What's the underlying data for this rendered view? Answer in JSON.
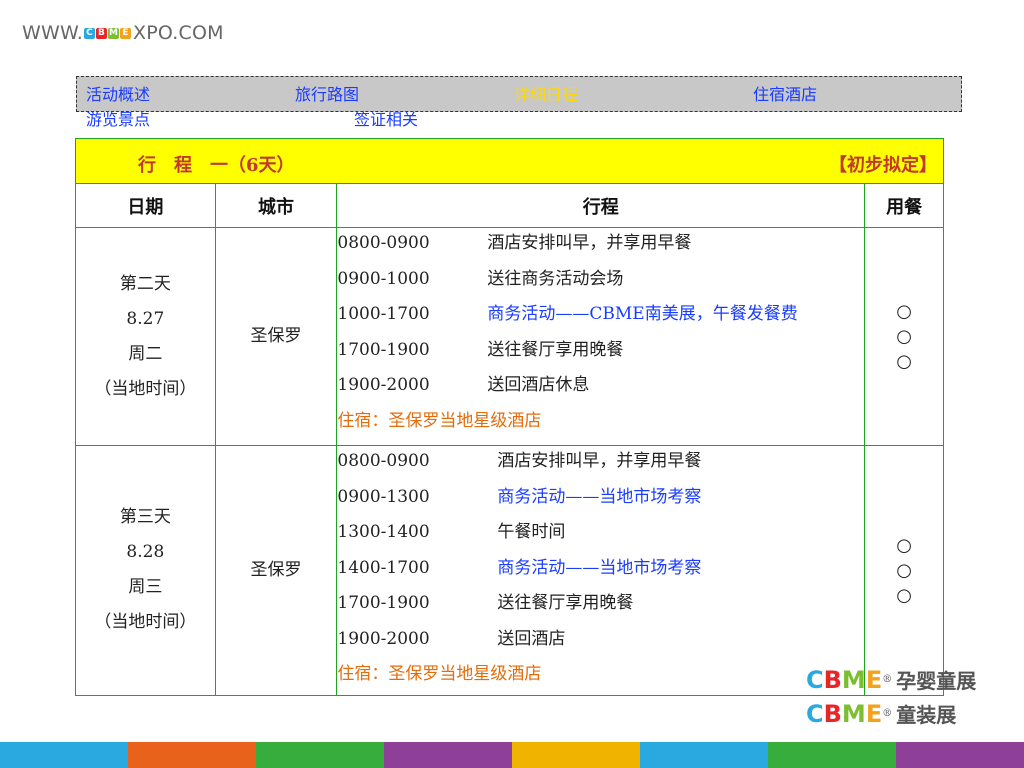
{
  "site": {
    "prefix": "WWW.",
    "brand_letters": [
      "C",
      "B",
      "M",
      "E"
    ],
    "brand_colors": [
      "#2aa8e0",
      "#e8262a",
      "#7bbf2f",
      "#f5a21b"
    ],
    "suffix": "XPO.COM"
  },
  "nav": {
    "items": [
      {
        "label": "活动概述",
        "active": false
      },
      {
        "label": "旅行路图",
        "active": false
      },
      {
        "label": "详细日程",
        "active": true
      },
      {
        "label": "住宿酒店",
        "active": false
      }
    ],
    "row2": [
      {
        "label": "游览景点"
      },
      {
        "label": "签证相关"
      }
    ]
  },
  "table": {
    "title": "行　程　一（6天）",
    "note": "【初步拟定】",
    "headers": {
      "date": "日期",
      "city": "城市",
      "itinerary": "行程",
      "meal": "用餐"
    },
    "days": [
      {
        "day": "第二天",
        "date": "8.27",
        "weekday": "周二",
        "tz": "（当地时间）",
        "city": "圣保罗",
        "items": [
          {
            "time": "0800-0900",
            "desc": "酒店安排叫早，并享用早餐",
            "highlight": false
          },
          {
            "time": "0900-1000",
            "desc": "送往商务活动会场",
            "highlight": false
          },
          {
            "time": "1000-1700",
            "desc": "商务活动——CBME南美展，午餐发餐费",
            "highlight": true
          },
          {
            "time": "1700-1900",
            "desc": "送往餐厅享用晚餐",
            "highlight": false
          },
          {
            "time": "1900-2000",
            "desc": "送回酒店休息",
            "highlight": false
          }
        ],
        "stay": "住宿：圣保罗当地星级酒店",
        "meals": [
          "○",
          "○",
          "○"
        ]
      },
      {
        "day": "第三天",
        "date": "8.28",
        "weekday": "周三",
        "tz": "（当地时间）",
        "city": "圣保罗",
        "items": [
          {
            "time": "0800-0900",
            "desc": "酒店安排叫早，并享用早餐",
            "highlight": false
          },
          {
            "time": "0900-1300",
            "desc": "商务活动——当地市场考察",
            "highlight": true
          },
          {
            "time": "1300-1400",
            "desc": "午餐时间",
            "highlight": false
          },
          {
            "time": "1400-1700",
            "desc": "商务活动——当地市场考察",
            "highlight": true
          },
          {
            "time": "1700-1900",
            "desc": "送往餐厅享用晚餐",
            "highlight": false
          },
          {
            "time": "1900-2000",
            "desc": "送回酒店",
            "highlight": false
          }
        ],
        "stay": "住宿：圣保罗当地星级酒店",
        "meals": [
          "○",
          "○",
          "○"
        ]
      }
    ]
  },
  "brands": [
    {
      "letters": "CBME",
      "reg": "®",
      "text": "孕婴童展"
    },
    {
      "letters": "CBME",
      "reg": "®",
      "text": "童装展"
    }
  ],
  "stripe_colors": [
    "#2aa8e0",
    "#e8621c",
    "#37ad3d",
    "#8e3f97",
    "#f0b400",
    "#2aa8e0",
    "#37ad3d",
    "#8e3f97"
  ]
}
